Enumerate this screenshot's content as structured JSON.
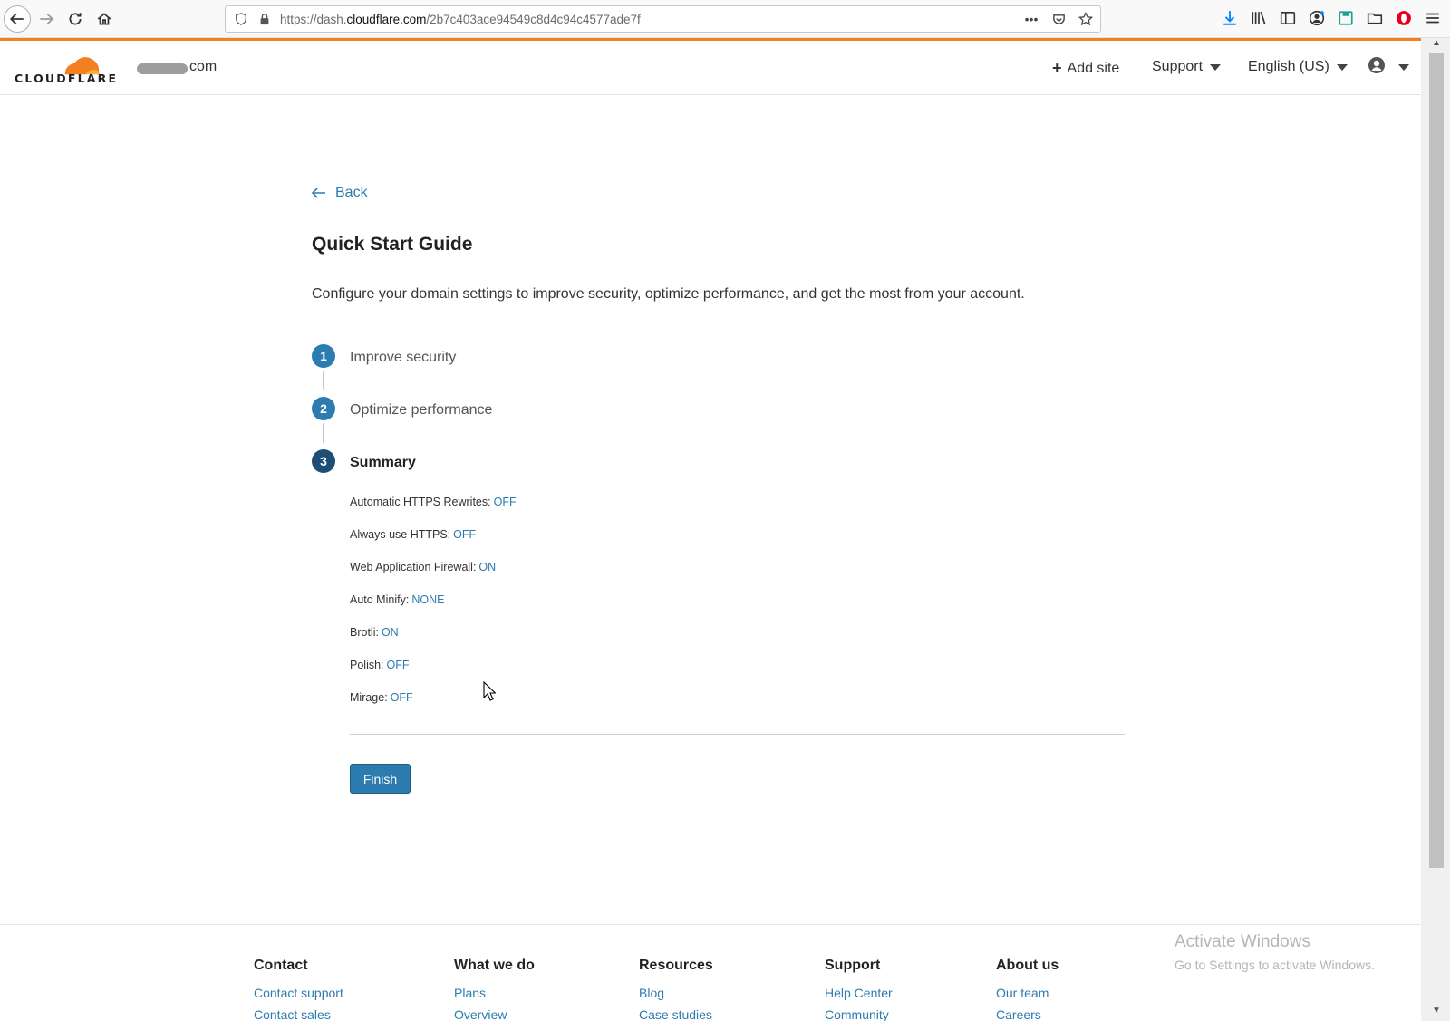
{
  "browser": {
    "url_prefix": "https://dash.",
    "url_domain": "cloudflare.com",
    "url_path": "/2b7c403ace94549c8d4c94c4577ade7f"
  },
  "header": {
    "logo_text": "CLOUDFLARE",
    "domain_suffix": "com",
    "add_site": "Add site",
    "support": "Support",
    "language": "English (US)"
  },
  "main": {
    "back": "Back",
    "title": "Quick Start Guide",
    "description": "Configure your domain settings to improve security, optimize performance, and get the most from your account.",
    "steps": [
      {
        "number": "1",
        "label": "Improve security"
      },
      {
        "number": "2",
        "label": "Optimize performance"
      },
      {
        "number": "3",
        "label": "Summary"
      }
    ],
    "summary": [
      {
        "label": "Automatic HTTPS Rewrites:",
        "value": "OFF"
      },
      {
        "label": "Always use HTTPS:",
        "value": "OFF"
      },
      {
        "label": "Web Application Firewall:",
        "value": "ON"
      },
      {
        "label": "Auto Minify:",
        "value": "NONE"
      },
      {
        "label": "Brotli:",
        "value": "ON"
      },
      {
        "label": "Polish:",
        "value": "OFF"
      },
      {
        "label": "Mirage:",
        "value": "OFF"
      }
    ],
    "finish": "Finish"
  },
  "footer": {
    "columns": [
      {
        "heading": "Contact",
        "links": [
          "Contact support",
          "Contact sales"
        ]
      },
      {
        "heading": "What we do",
        "links": [
          "Plans",
          "Overview"
        ]
      },
      {
        "heading": "Resources",
        "links": [
          "Blog",
          "Case studies"
        ]
      },
      {
        "heading": "Support",
        "links": [
          "Help Center",
          "Community"
        ]
      },
      {
        "heading": "About us",
        "links": [
          "Our team",
          "Careers"
        ]
      }
    ]
  },
  "watermark": {
    "line1": "Activate Windows",
    "line2": "Go to Settings to activate Windows."
  },
  "colors": {
    "brand_orange": "#f38020",
    "link_blue": "#2c7cb0",
    "active_step": "#1e4d75"
  }
}
